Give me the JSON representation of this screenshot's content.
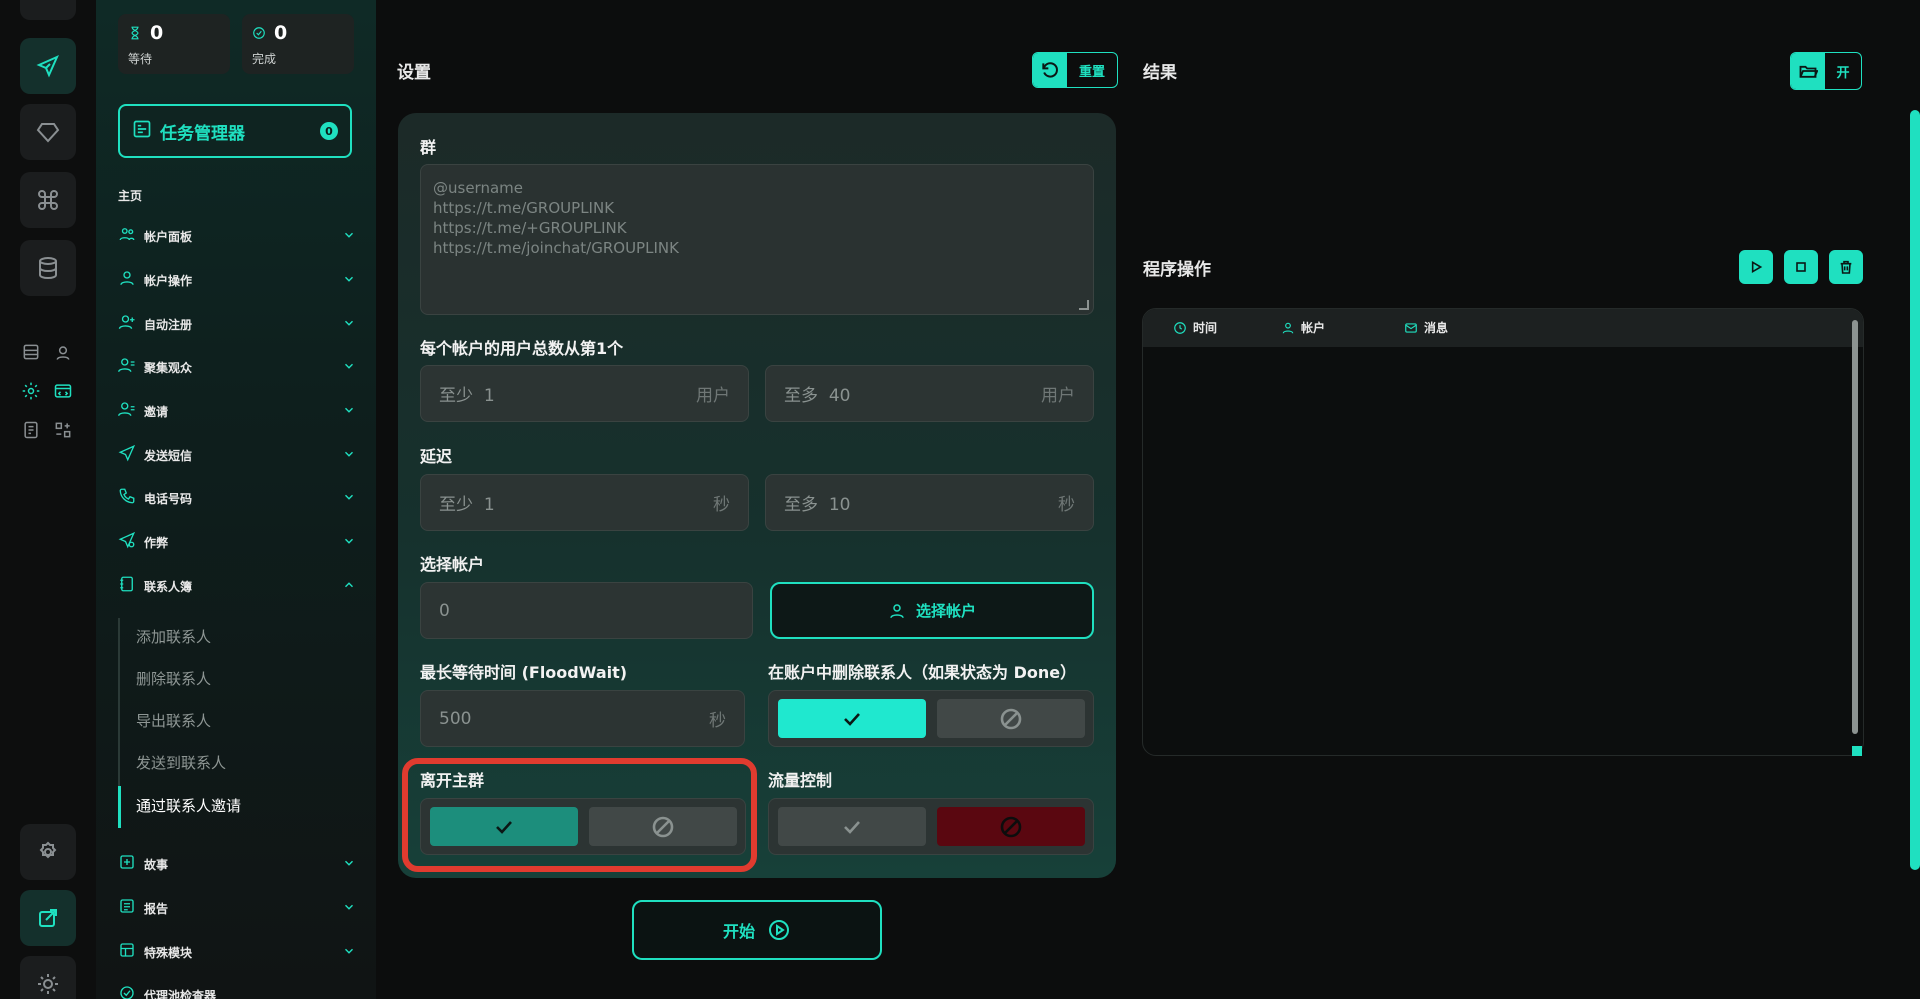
{
  "stats": {
    "waiting": {
      "value": "0",
      "label": "等待"
    },
    "done": {
      "value": "0",
      "label": "完成"
    }
  },
  "task_manager": {
    "label": "任务管理器",
    "badge": "0"
  },
  "sidebar": {
    "section_title": "主页",
    "items": [
      {
        "label": "帐户面板",
        "icon": "users-icon"
      },
      {
        "label": "帐户操作",
        "icon": "user-icon"
      },
      {
        "label": "自动注册",
        "icon": "user-plus-icon"
      },
      {
        "label": "聚集观众",
        "icon": "audience-icon"
      },
      {
        "label": "邀请",
        "icon": "invite-icon"
      },
      {
        "label": "发送短信",
        "icon": "send-icon"
      },
      {
        "label": "电话号码",
        "icon": "phone-icon"
      },
      {
        "label": "作弊",
        "icon": "cheat-icon"
      },
      {
        "label": "联系人簿",
        "icon": "contacts-icon"
      }
    ],
    "contacts_sub": [
      "添加联系人",
      "删除联系人",
      "导出联系人",
      "发送到联系人",
      "通过联系人邀请"
    ],
    "bottom_items": [
      {
        "label": "故事",
        "icon": "story-icon"
      },
      {
        "label": "报告",
        "icon": "report-icon"
      },
      {
        "label": "特殊模块",
        "icon": "module-icon"
      },
      {
        "label": "代理池检查器",
        "icon": "proxy-icon"
      }
    ]
  },
  "settings": {
    "title": "设置",
    "reset_label": "重置",
    "group_label": "群",
    "group_placeholder": "@username\nhttps://t.me/GROUPLINK\nhttps://t.me/+GROUPLINK\nhttps://t.me/joinchat/GROUPLINK",
    "users_label": "每个帐户的用户总数从第1个",
    "users_min": {
      "prefix": "至少",
      "value": "1",
      "unit": "用户"
    },
    "users_max": {
      "prefix": "至多",
      "value": "40",
      "unit": "用户"
    },
    "delay_label": "延迟",
    "delay_min": {
      "prefix": "至少",
      "value": "1",
      "unit": "秒"
    },
    "delay_max": {
      "prefix": "至多",
      "value": "10",
      "unit": "秒"
    },
    "select_account_label": "选择帐户",
    "select_account_value": "0",
    "select_account_button": "选择帐户",
    "floodwait_label": "最长等待时间 (FloodWait)",
    "floodwait_value": "500",
    "floodwait_unit": "秒",
    "delete_contacts_label": "在账户中删除联系人（如果状态为 Done）",
    "leave_group_label": "离开主群",
    "flow_control_label": "流量控制",
    "start_label": "开始"
  },
  "results": {
    "title": "结果",
    "open_label": "开"
  },
  "program_ops": {
    "title": "程序操作",
    "columns": [
      "时间",
      "帐户",
      "消息"
    ]
  },
  "colors": {
    "accent": "#1fe0c0",
    "danger": "#5a0710",
    "highlight": "#e03b2f"
  }
}
